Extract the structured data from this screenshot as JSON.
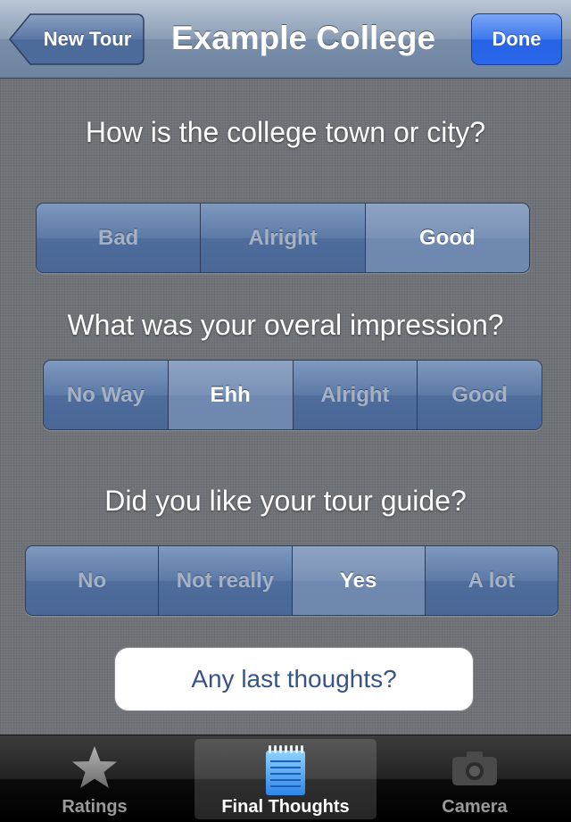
{
  "navbar": {
    "back_label": "New Tour",
    "title": "Example College",
    "done_label": "Done"
  },
  "questions": [
    {
      "text": "How is the college town or city?",
      "options": [
        "Bad",
        "Alright",
        "Good"
      ],
      "selected": "Good"
    },
    {
      "text": "What was your overal impression?",
      "options": [
        "No Way",
        "Ehh",
        "Alright",
        "Good"
      ],
      "selected": "Ehh"
    },
    {
      "text": "Did you like your tour guide?",
      "options": [
        "No",
        "Not really",
        "Yes",
        "A lot"
      ],
      "selected": "Yes"
    }
  ],
  "thoughts_button": "Any last thoughts?",
  "tabs": [
    {
      "label": "Ratings",
      "icon": "star-icon",
      "selected": false
    },
    {
      "label": "Final Thoughts",
      "icon": "notepad-icon",
      "selected": true
    },
    {
      "label": "Camera",
      "icon": "camera-icon",
      "selected": false
    }
  ],
  "colors": {
    "nav_accent": "#6d83a0",
    "done_button": "#2663e6",
    "segment": "#5c7aa7",
    "segment_selected": "#7a92b7",
    "thoughts_text": "#385487"
  }
}
